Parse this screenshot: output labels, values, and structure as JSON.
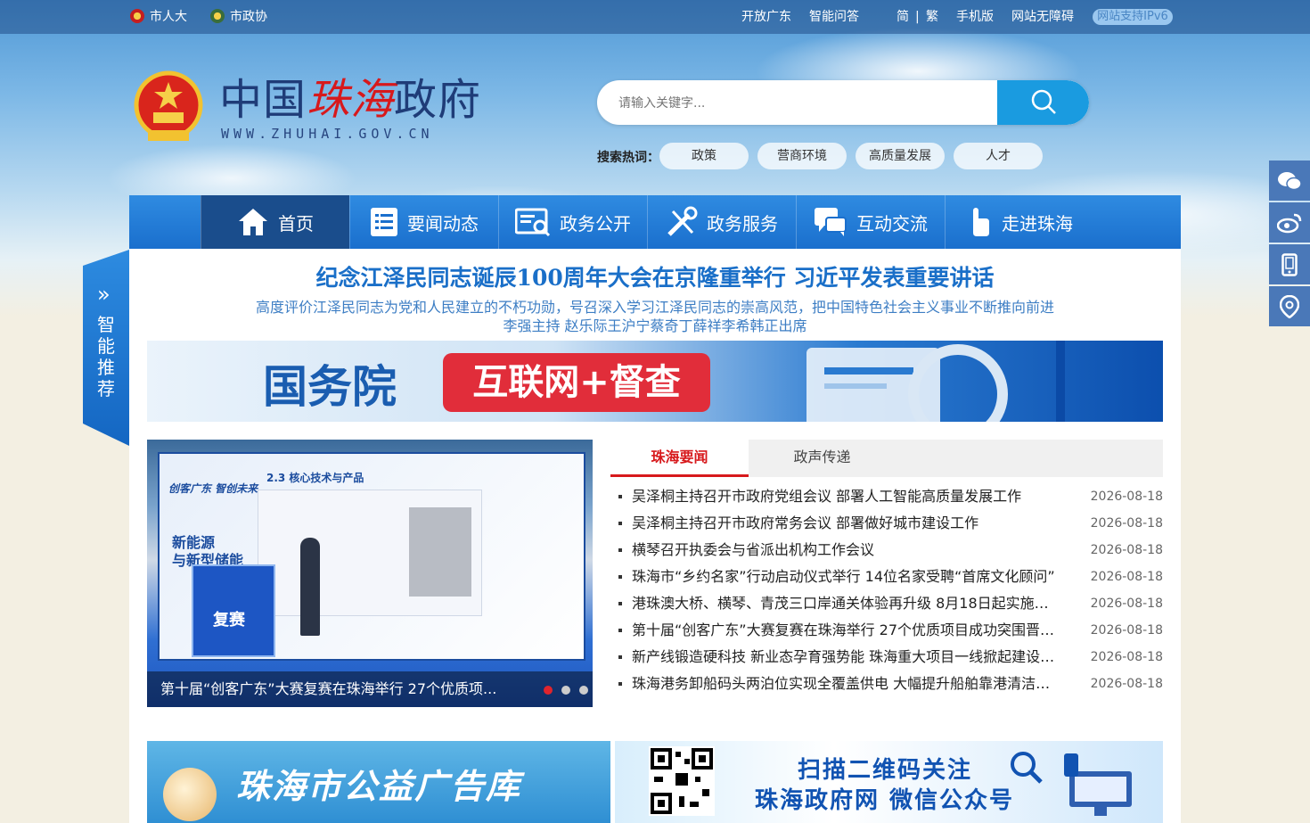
{
  "topbar": {
    "left_links": [
      "市人大",
      "市政协"
    ],
    "right_links": [
      "开放广东",
      "智能问答",
      "简",
      "|",
      "繁",
      "手机版",
      "网站无障碍"
    ],
    "ipv6": "网站支持IPv6"
  },
  "logo": {
    "title_a": "中国",
    "title_b": "珠海",
    "title_c": "政府",
    "url": "WWW.ZHUHAI.GOV.CN"
  },
  "search": {
    "placeholder": "请输入关键字...",
    "hot_label": "搜索热词：",
    "hot_tags": [
      "政策",
      "营商环境",
      "高质量发展",
      "人才"
    ]
  },
  "nav": {
    "items": [
      "首页",
      "要闻动态",
      "政务公开",
      "政务服务",
      "互动交流",
      "走进珠海"
    ]
  },
  "side_tab": {
    "label": "智能推荐",
    "arrows": "»"
  },
  "headline": {
    "title": "纪念江泽民同志诞辰100周年大会在京隆重举行 习近平发表重要讲话",
    "sub1": "高度评价江泽民同志为党和人民建立的不朽功勋，号召深入学习江泽民同志的崇高风范，把中国特色社会主义事业不断推向前进",
    "sub2": "李强主持 赵乐际王沪宁蔡奇丁薛祥李希韩正出席"
  },
  "banner1": {
    "a": "国务院",
    "b": "互联网+督查"
  },
  "slide": {
    "caption": "第十届“创客广东”大赛复赛在珠海举行 27个优质项...",
    "screen_title": "2.3 核心技术与产品",
    "stage_text_1": "新能源",
    "stage_text_2": "与新型储能",
    "stage_banner": "创客广东 智创未来",
    "podium": "复赛"
  },
  "news_tabs": [
    "珠海要闻",
    "政声传递"
  ],
  "news": [
    {
      "title": "吴泽桐主持召开市政府党组会议 部署人工智能高质量发展工作",
      "date": "2026-08-18"
    },
    {
      "title": "吴泽桐主持召开市政府常务会议 部署做好城市建设工作",
      "date": "2026-08-18"
    },
    {
      "title": "横琴召开执委会与省派出机构工作会议",
      "date": "2026-08-18"
    },
    {
      "title": "珠海市“乡约名家”行动启动仪式举行 14位名家受聘“首席文化顾问”",
      "date": "2026-08-18"
    },
    {
      "title": "港珠澳大桥、横琴、青茂三口岸通关体验再升级 8月18日起实施三…",
      "date": "2026-08-18"
    },
    {
      "title": "第十届“创客广东”大赛复赛在珠海举行 27个优质项目成功突围晋…",
      "date": "2026-08-18"
    },
    {
      "title": "新产线锻造硬科技 新业态孕育强势能 珠海重大项目一线掀起建设…",
      "date": "2026-08-18"
    },
    {
      "title": "珠海港务卸船码头两泊位实现全覆盖供电 大幅提升船舶靠港清洁…",
      "date": "2026-08-18"
    }
  ],
  "banner2": {
    "text": "珠海市公益广告库"
  },
  "banner3": {
    "line1": "扫描二维码关注",
    "line2": "珠海政府网 微信公众号"
  },
  "float_icons": [
    "wechat-icon",
    "weibo-icon",
    "mobile-icon",
    "location-icon"
  ],
  "colors": {
    "primary": "#1a6fcd",
    "active_nav": "#1a4d8c",
    "accent_red": "#d7191c"
  }
}
